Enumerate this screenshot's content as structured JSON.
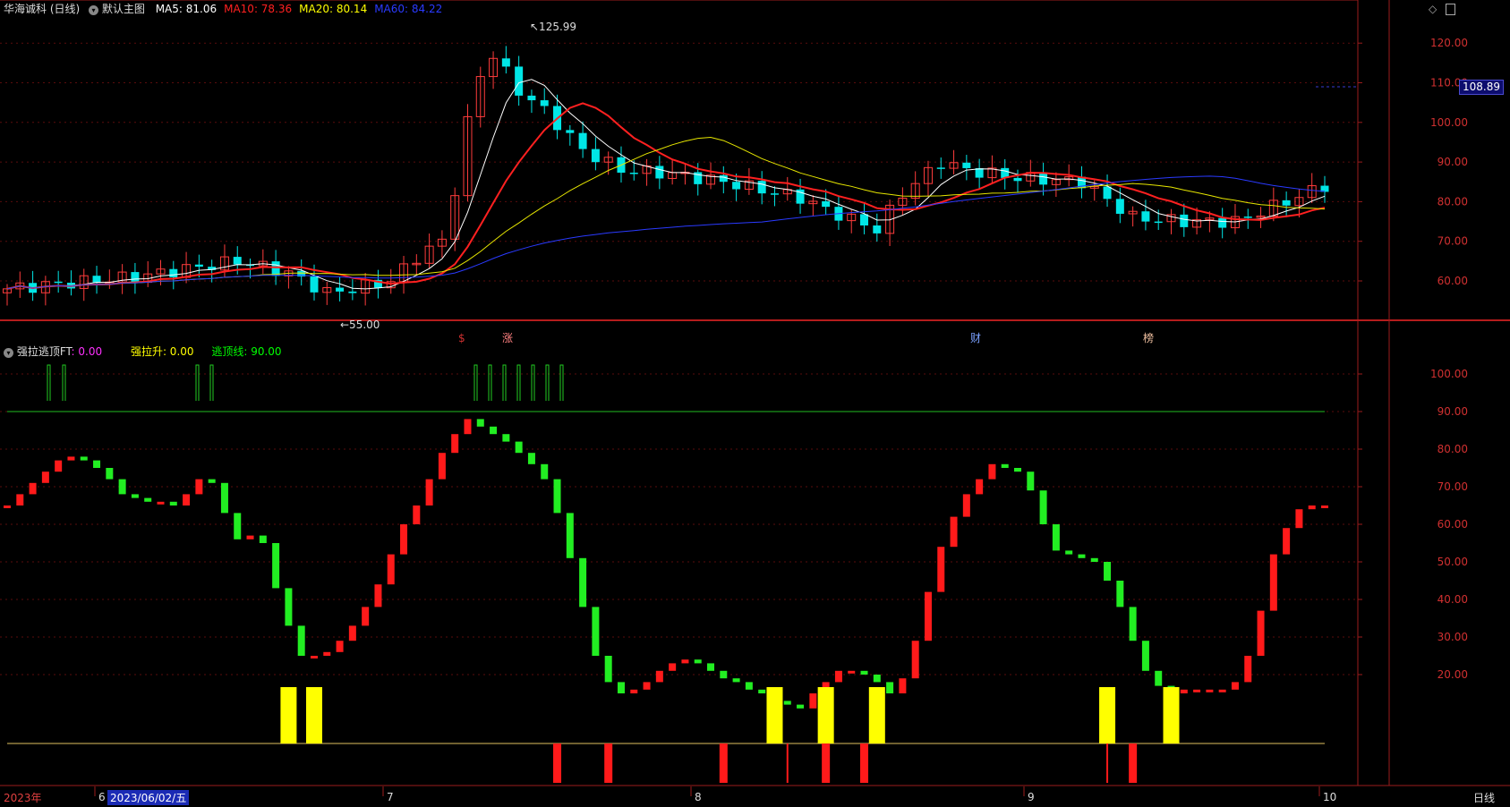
{
  "main": {
    "stock_name": "华海诚科 (日线)",
    "template": "默认主图",
    "ma": [
      {
        "label": "MA5: 81.06",
        "color": "#ffffff"
      },
      {
        "label": "MA10: 78.36",
        "color": "#ff2020"
      },
      {
        "label": "MA20: 80.14",
        "color": "#ffff00"
      },
      {
        "label": "MA60: 84.22",
        "color": "#2a3aff"
      }
    ],
    "price_ticks": [
      "120.00",
      "110.00",
      "100.00",
      "90.00",
      "80.00",
      "70.00",
      "60.00"
    ],
    "current_price": "108.89",
    "high_label": "125.99",
    "low_label": "55.00",
    "event_markers": [
      "$",
      "涨",
      "财",
      "榜"
    ]
  },
  "indicator": {
    "name": "强拉逃顶FT",
    "value1": ": 0.00",
    "series2": "强拉升: 0.00",
    "series3": "逃顶线: 90.00",
    "ticks": [
      "100.00",
      "90.00",
      "80.00",
      "70.00",
      "60.00",
      "50.00",
      "40.00",
      "30.00",
      "20.00"
    ],
    "values": [
      65,
      68,
      71,
      74,
      77,
      78,
      77,
      75,
      72,
      68,
      67,
      66,
      66,
      65,
      68,
      72,
      71,
      63,
      56,
      57,
      55,
      43,
      33,
      25,
      25,
      26,
      29,
      33,
      38,
      44,
      52,
      60,
      65,
      72,
      79,
      84,
      88,
      86,
      84,
      82,
      79,
      76,
      72,
      63,
      51,
      38,
      25,
      18,
      15,
      16,
      18,
      21,
      23,
      24,
      23,
      21,
      19,
      18,
      16,
      15,
      13,
      12,
      11,
      15,
      18,
      21,
      21,
      20,
      18,
      15,
      19,
      29,
      42,
      54,
      62,
      68,
      72,
      76,
      75,
      74,
      69,
      60,
      53,
      52,
      51,
      50,
      45,
      38,
      29,
      21,
      17,
      15,
      16,
      16,
      16,
      16,
      18,
      25,
      37,
      52,
      59,
      64,
      65,
      65
    ],
    "yellow_bars": [
      22,
      24,
      60,
      64,
      68,
      86,
      91
    ],
    "red_spikes": [
      43,
      47,
      56,
      61,
      64,
      67,
      86,
      88
    ]
  },
  "footer": {
    "year": "2023年",
    "months": [
      "6",
      "7",
      "8",
      "9",
      "10"
    ],
    "selected_date": "2023/06/02/五",
    "period": "日线"
  }
}
